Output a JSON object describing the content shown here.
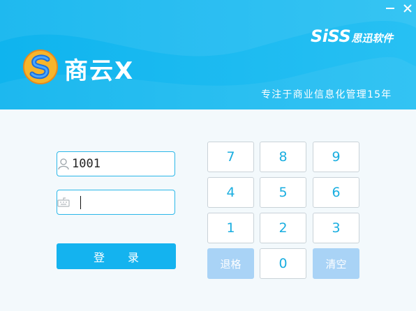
{
  "window": {
    "minimize_glyph": "−",
    "close_glyph": "✕"
  },
  "brand": {
    "latin": "SiSS",
    "chinese": "思迅软件"
  },
  "app": {
    "name": "商云X",
    "slogan": "专注于商业信息化管理15年"
  },
  "login": {
    "username_value": "1001",
    "password_value": "",
    "submit_label": "登 录"
  },
  "keypad": {
    "keys": [
      "7",
      "8",
      "9",
      "4",
      "5",
      "6",
      "1",
      "2",
      "3",
      "退格",
      "0",
      "清空"
    ]
  },
  "colors": {
    "accent": "#14b3ef",
    "banner": "#19b9f0",
    "function_key": "#a9d3f6"
  }
}
